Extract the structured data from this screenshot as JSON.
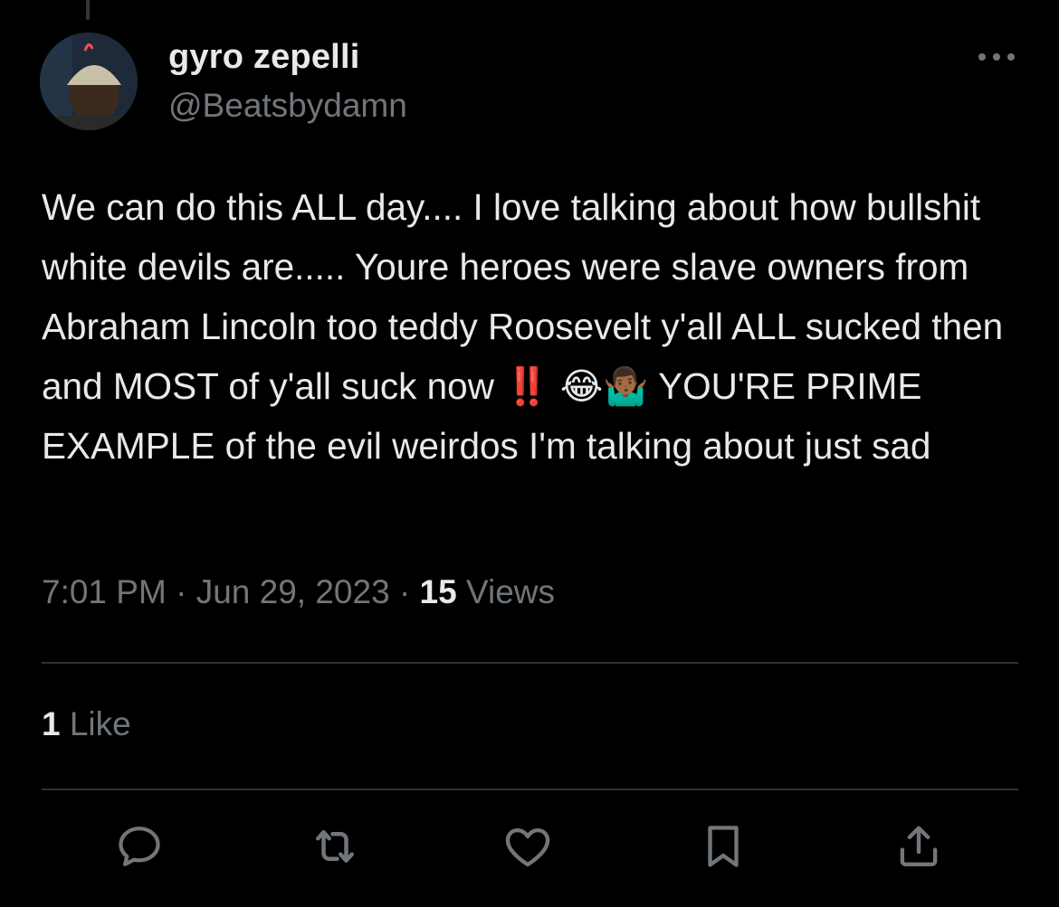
{
  "author": {
    "display_name": "gyro zepelli",
    "handle": "@Beatsbydamn"
  },
  "tweet": {
    "text": "We can do this ALL day.... I love talking about how bullshit white devils are..... Youre heroes were slave owners from Abraham Lincoln too teddy Roosevelt y'all ALL sucked then and MOST of y'all suck now ‼️ 😂🤷🏾‍♂️ YOU'RE PRIME EXAMPLE of the evil weirdos I'm talking about just sad"
  },
  "meta": {
    "time": "7:01 PM",
    "separator": "·",
    "date": "Jun 29, 2023",
    "views_count": "15",
    "views_label": "Views"
  },
  "engagement": {
    "likes_count": "1",
    "likes_label": "Like"
  },
  "actions": [
    {
      "icon": "reply-icon"
    },
    {
      "icon": "retweet-icon"
    },
    {
      "icon": "heart-icon"
    },
    {
      "icon": "bookmark-icon"
    },
    {
      "icon": "share-icon"
    }
  ],
  "colors": {
    "background": "#000000",
    "primary_text": "#e7e9ea",
    "secondary_text": "#71767b",
    "divider": "#2f3336"
  }
}
